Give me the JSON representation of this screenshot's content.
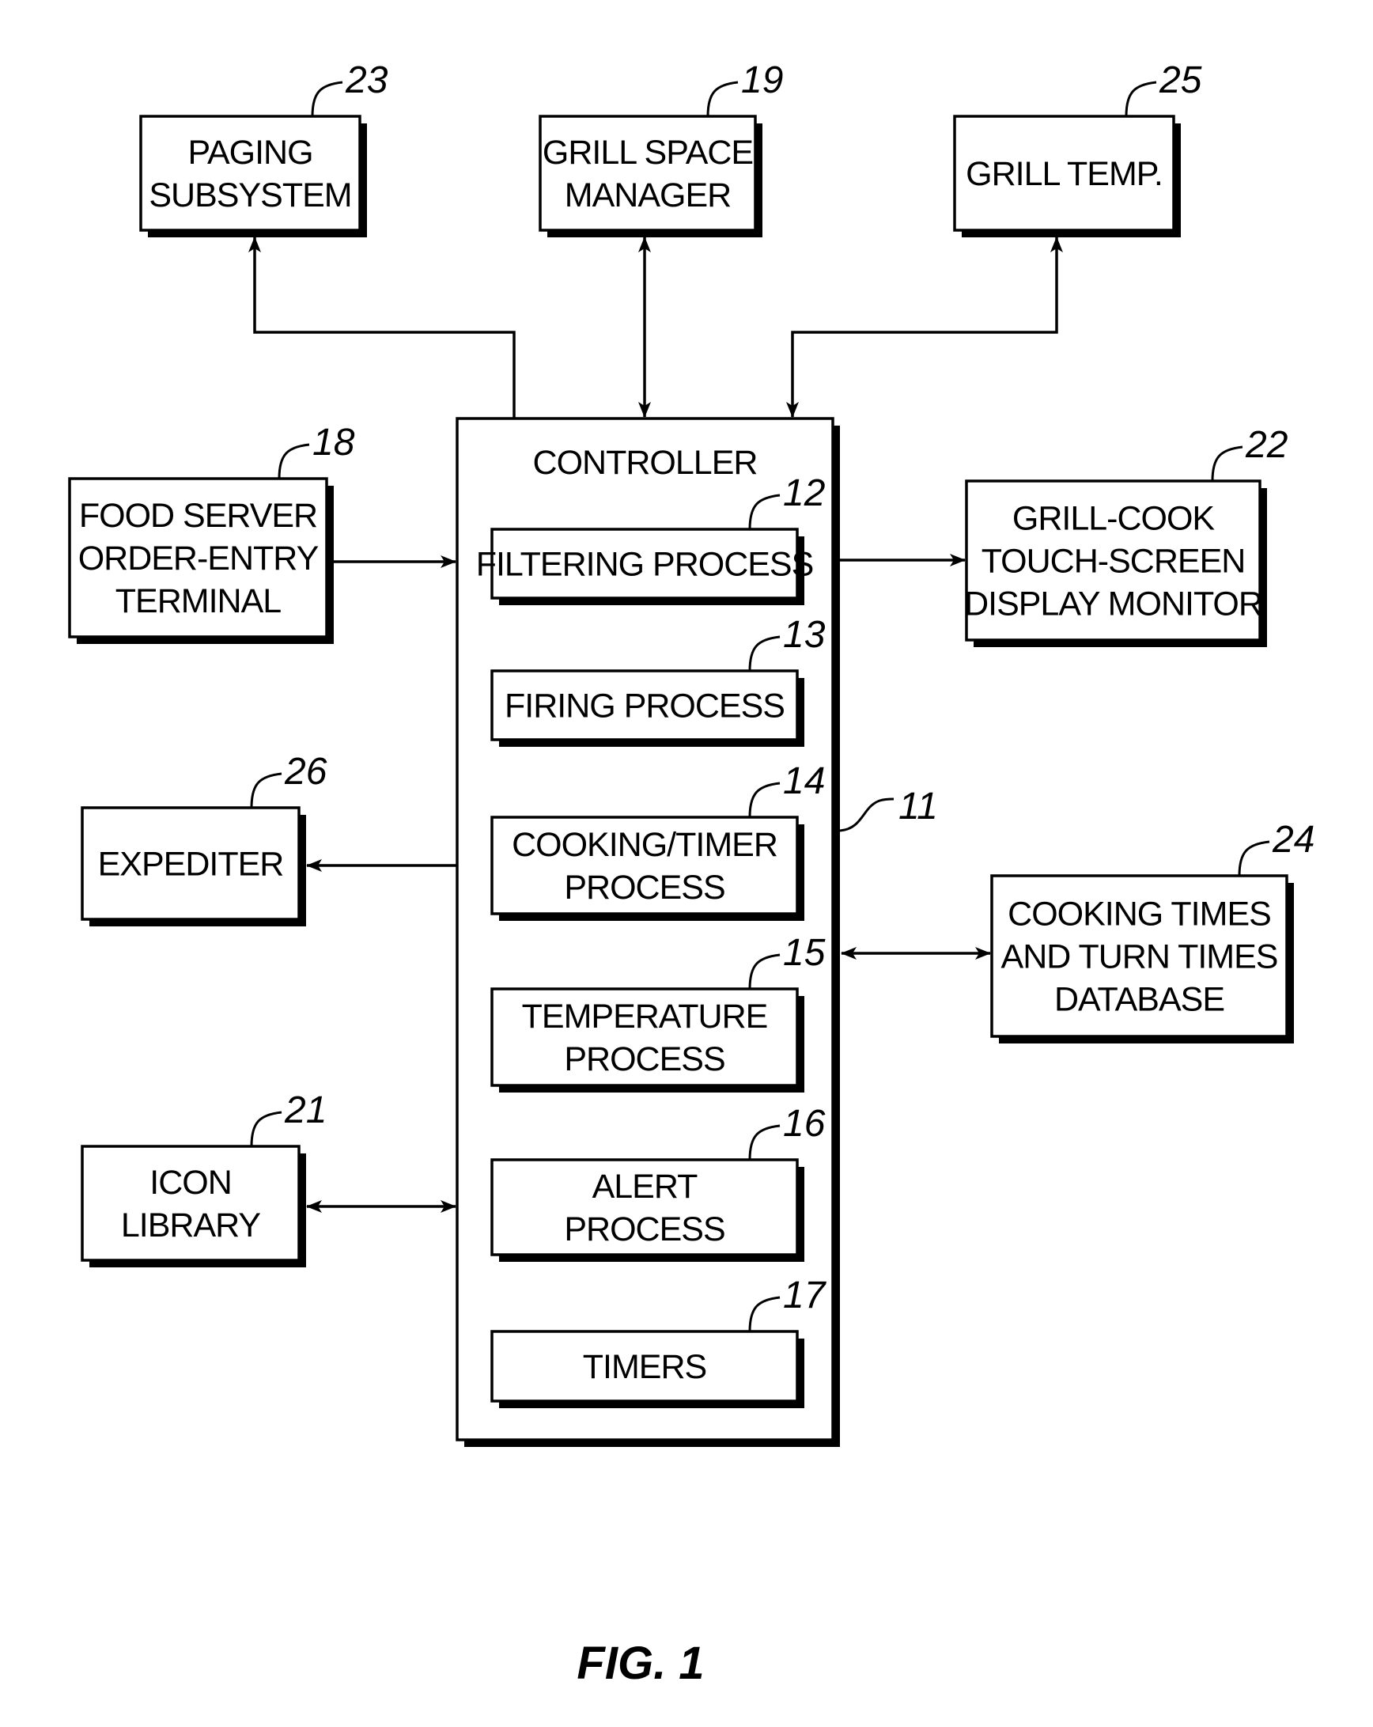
{
  "figure": {
    "caption": "FIG. 1"
  },
  "controller": {
    "ref": "11",
    "label": "CONTROLLER"
  },
  "processes": [
    {
      "id": "filtering-process",
      "ref": "12",
      "lines": [
        "FILTERING PROCESS"
      ]
    },
    {
      "id": "firing-process",
      "ref": "13",
      "lines": [
        "FIRING PROCESS"
      ]
    },
    {
      "id": "cooking-timer-process",
      "ref": "14",
      "lines": [
        "COOKING/TIMER",
        "PROCESS"
      ]
    },
    {
      "id": "temperature-process",
      "ref": "15",
      "lines": [
        "TEMPERATURE",
        "PROCESS"
      ]
    },
    {
      "id": "alert-process",
      "ref": "16",
      "lines": [
        "ALERT",
        "PROCESS"
      ]
    },
    {
      "id": "timers",
      "ref": "17",
      "lines": [
        "TIMERS"
      ]
    }
  ],
  "external_blocks": [
    {
      "id": "paging-subsystem",
      "ref": "23",
      "lines": [
        "PAGING",
        "SUBSYSTEM"
      ]
    },
    {
      "id": "grill-space-manager",
      "ref": "19",
      "lines": [
        "GRILL SPACE",
        "MANAGER"
      ]
    },
    {
      "id": "grill-temp",
      "ref": "25",
      "lines": [
        "GRILL  TEMP."
      ]
    },
    {
      "id": "food-server-terminal",
      "ref": "18",
      "lines": [
        "FOOD SERVER",
        "ORDER-ENTRY",
        "TERMINAL"
      ]
    },
    {
      "id": "grill-cook-display",
      "ref": "22",
      "lines": [
        "GRILL-COOK",
        "TOUCH-SCREEN",
        "DISPLAY MONITOR"
      ]
    },
    {
      "id": "expediter",
      "ref": "26",
      "lines": [
        "EXPEDITER"
      ]
    },
    {
      "id": "cooking-times-database",
      "ref": "24",
      "lines": [
        "COOKING TIMES",
        "AND TURN TIMES",
        "DATABASE"
      ]
    },
    {
      "id": "icon-library",
      "ref": "21",
      "lines": [
        "ICON",
        "LIBRARY"
      ]
    }
  ],
  "connections": [
    {
      "from": "controller",
      "to": "paging-subsystem",
      "direction": "one-way"
    },
    {
      "from": "controller",
      "to": "grill-space-manager",
      "direction": "two-way"
    },
    {
      "from": "controller",
      "to": "grill-temp",
      "direction": "two-way"
    },
    {
      "from": "food-server-terminal",
      "to": "controller",
      "direction": "one-way"
    },
    {
      "from": "controller",
      "to": "grill-cook-display",
      "direction": "one-way"
    },
    {
      "from": "controller",
      "to": "expediter",
      "direction": "one-way"
    },
    {
      "from": "controller",
      "to": "cooking-times-database",
      "direction": "two-way"
    },
    {
      "from": "controller",
      "to": "icon-library",
      "direction": "two-way"
    }
  ]
}
